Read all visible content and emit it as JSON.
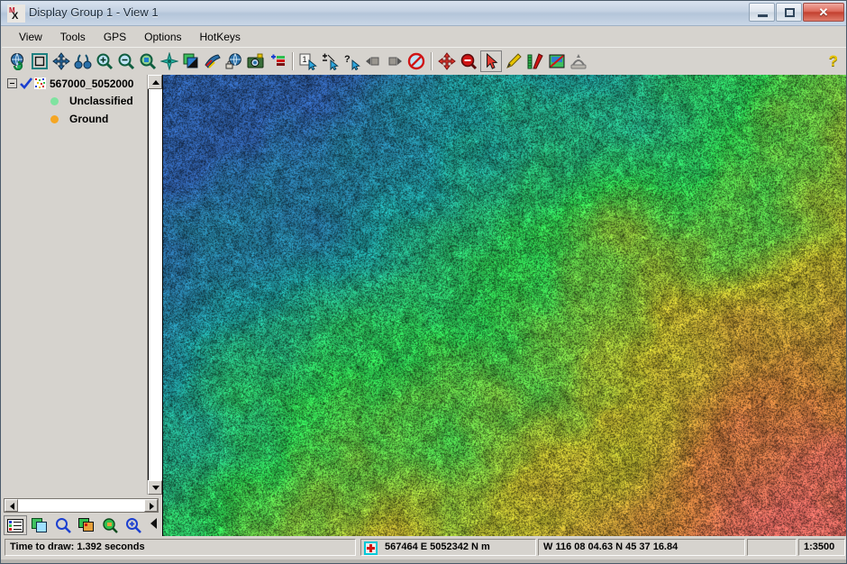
{
  "window": {
    "title": "Display Group 1 - View 1",
    "app_icon": "mx-app-icon",
    "buttons": {
      "minimize": "minimize-button",
      "maximize": "maximize-button",
      "close_glyph": "✕"
    }
  },
  "menu": {
    "items": [
      {
        "label": "View",
        "name": "menu-view"
      },
      {
        "label": "Tools",
        "name": "menu-tools"
      },
      {
        "label": "GPS",
        "name": "menu-gps"
      },
      {
        "label": "Options",
        "name": "menu-options"
      },
      {
        "label": "HotKeys",
        "name": "menu-hotkeys"
      }
    ]
  },
  "toolbar": {
    "group1": [
      {
        "icon": "globe-refresh-icon",
        "name": "toolbar-globe-refresh"
      },
      {
        "icon": "fit-window-icon",
        "name": "toolbar-fit-window"
      },
      {
        "icon": "pan-icon",
        "name": "toolbar-pan"
      },
      {
        "icon": "binoculars-icon",
        "name": "toolbar-binoculars"
      },
      {
        "icon": "zoom-in-icon",
        "name": "toolbar-zoom-in"
      },
      {
        "icon": "zoom-out-icon",
        "name": "toolbar-zoom-out"
      },
      {
        "icon": "zoom-region-icon",
        "name": "toolbar-zoom-region"
      },
      {
        "icon": "sparkle-icon",
        "name": "toolbar-sparkle"
      },
      {
        "icon": "layers-icon",
        "name": "toolbar-layers"
      },
      {
        "icon": "color-tools-icon",
        "name": "toolbar-color-tools"
      },
      {
        "icon": "globe-lock-icon",
        "name": "toolbar-globe-lock"
      },
      {
        "icon": "camera-icon",
        "name": "toolbar-camera"
      },
      {
        "icon": "add-layer-icon",
        "name": "toolbar-add-layer"
      }
    ],
    "group2": [
      {
        "icon": "select-one-icon",
        "name": "toolbar-select-one"
      },
      {
        "icon": "select-plus-minus-icon",
        "name": "toolbar-select-plus-minus"
      },
      {
        "icon": "query-select-icon",
        "name": "toolbar-query-select"
      },
      {
        "icon": "step-back-icon",
        "name": "toolbar-step-back"
      },
      {
        "icon": "step-forward-icon",
        "name": "toolbar-step-forward"
      },
      {
        "icon": "no-entry-icon",
        "name": "toolbar-no-entry"
      },
      {
        "icon": "move-crosshair-icon",
        "name": "toolbar-move-crosshair"
      },
      {
        "icon": "zoom-out-circle-icon",
        "name": "toolbar-zoom-out-circle"
      },
      {
        "icon": "arrow-pointer-icon",
        "name": "toolbar-arrow-pointer",
        "active": true
      },
      {
        "icon": "pencil-icon",
        "name": "toolbar-pencil"
      },
      {
        "icon": "ruler-icon",
        "name": "toolbar-ruler"
      },
      {
        "icon": "image-edit-icon",
        "name": "toolbar-image-edit"
      },
      {
        "icon": "profile-view-icon",
        "name": "toolbar-profile-view"
      }
    ],
    "help_glyph": "?"
  },
  "tree": {
    "root": {
      "label": "567000_5052000",
      "checked": true,
      "expanded": true
    },
    "children": [
      {
        "label": "Unclassified",
        "color": "#7fe3a0"
      },
      {
        "label": "Ground",
        "color": "#f5a623"
      }
    ]
  },
  "panel_tools": [
    {
      "icon": "legend-list-icon",
      "name": "panel-legend-list",
      "active": true
    },
    {
      "icon": "duplicate-layer-icon",
      "name": "panel-duplicate-layer"
    },
    {
      "icon": "magnifier-icon",
      "name": "panel-magnifier"
    },
    {
      "icon": "image-thumbnail-icon",
      "name": "panel-image-thumbnail"
    },
    {
      "icon": "image-zoom-icon",
      "name": "panel-image-zoom"
    },
    {
      "icon": "zoom-plus-icon",
      "name": "panel-zoom-plus"
    }
  ],
  "status": {
    "draw_time": "Time to draw: 1.392 seconds",
    "cursor_icon": "crosshair-target-icon",
    "projected_coords": "567464 E  5052342 N  m",
    "geographic_coords": "W 116 08 04.63   N 45 37 16.84",
    "blank_cell": "",
    "scale": "1:3500"
  },
  "map": {
    "name": "lidar-point-cloud-view",
    "colors": {
      "low": "#2f5fa8",
      "low_mid": "#1f9b9b",
      "mid": "#2fcc4f",
      "mid_high": "#b9b62f",
      "high": "#c87c3a",
      "highest": "#e0695f",
      "shadow": "#1a2a1a"
    }
  }
}
